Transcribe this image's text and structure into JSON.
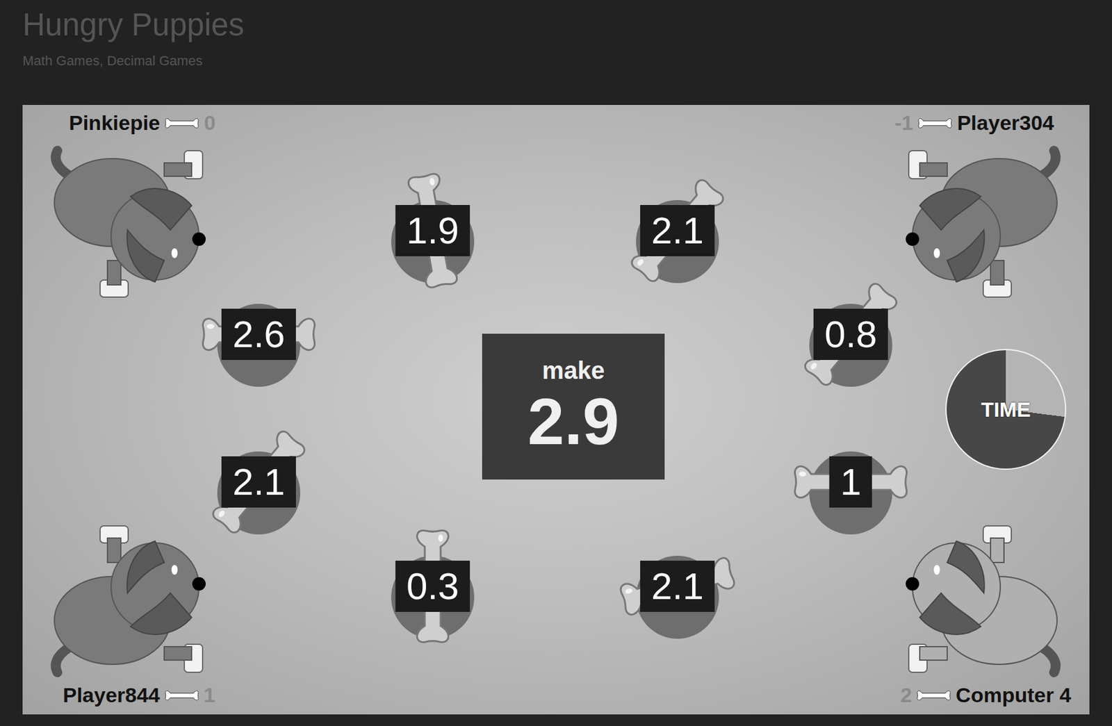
{
  "page": {
    "title": "Hungry Puppies",
    "subtitle": "Math Games, Decimal Games"
  },
  "players": [
    {
      "name": "Pinkiepie",
      "score": "0",
      "color": "#7a7a7a"
    },
    {
      "name": "Player304",
      "score": "-1",
      "color": "#7a7a7a"
    },
    {
      "name": "Player844",
      "score": "1",
      "color": "#7a7a7a"
    },
    {
      "name": "Computer 4",
      "score": "2",
      "color": "#b0b0b0"
    }
  ],
  "target": {
    "label": "make",
    "value": "2.9"
  },
  "bones": [
    {
      "value": "1.9"
    },
    {
      "value": "2.1"
    },
    {
      "value": "2.6"
    },
    {
      "value": "0.8"
    },
    {
      "value": "2.1"
    },
    {
      "value": "1"
    },
    {
      "value": "0.3"
    },
    {
      "value": "2.1"
    }
  ],
  "timer": {
    "label": "TIME",
    "level": 0.73
  }
}
